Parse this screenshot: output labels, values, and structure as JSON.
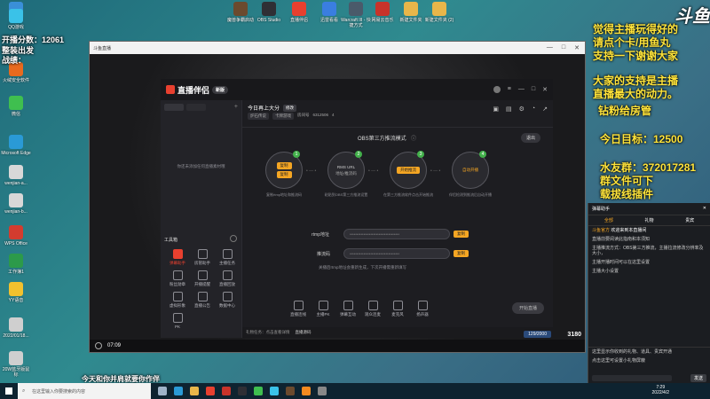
{
  "desktop": {
    "icons_left": [
      {
        "label": "此电脑",
        "color": "#3a8fd8"
      },
      {
        "label": "QQ游戏",
        "color": "#3ac2e8"
      },
      {
        "label": "火绒安全软件",
        "color": "#e86a1f"
      },
      {
        "label": "微信",
        "color": "#3fbf4f"
      },
      {
        "label": "Microsoft Edge",
        "color": "#2a9ad6"
      },
      {
        "label": "wenjian-a...",
        "color": "#d8d8d8"
      },
      {
        "label": "wenjian-b...",
        "color": "#d8d8d8"
      },
      {
        "label": "WPS Office",
        "color": "#d33c2f"
      },
      {
        "label": "工作簿1",
        "color": "#2c9a4a"
      },
      {
        "label": "YY语音",
        "color": "#f2c12e"
      },
      {
        "label": "2022/01/18...",
        "color": "#cfcfcf"
      },
      {
        "label": "20W蓝牙版鼠标",
        "color": "#cfcfcf"
      }
    ],
    "icons_top": [
      {
        "label": "魔兽争霸启动",
        "color": "#6b4a2e"
      },
      {
        "label": "OBS Studio",
        "color": "#2f2f35"
      },
      {
        "label": "直播伴侣",
        "color": "#e8402f"
      },
      {
        "label": "迅雷看看",
        "color": "#3a7ee0"
      },
      {
        "label": "Warcraft III - 快捷方式",
        "color": "#4a5a6a"
      },
      {
        "label": "网易云音乐",
        "color": "#c8332a"
      },
      {
        "label": "新建文件夹",
        "color": "#e8b64a"
      },
      {
        "label": "新建文件夹 (2)",
        "color": "#e8b64a"
      }
    ]
  },
  "overlay": {
    "score": "开播分数：12061",
    "left_line2": "整装出发",
    "left_line3": "战绩：",
    "right_l1": "觉得主播玩得好的",
    "right_l2": "请点个卡/用鱼丸",
    "right_l3": "支持一下谢谢大家",
    "right_l4": "大家的支持是主播",
    "right_l5": "直播最大的动力。",
    "right_l6": "钻粉给房管",
    "right_l7": "今日目标：12500",
    "right_l8": "水友群：372017281",
    "right_l9": "群文件可下",
    "right_l10": "载拔线插件",
    "bottom_caption": "今天和你并肩就要你作伴",
    "douyu_logo": "斗鱼"
  },
  "window": {
    "title": "斗鱼直播",
    "time": "07:09",
    "counter": "129/2000",
    "gold": "3180"
  },
  "app": {
    "name": "直播伴侣",
    "badge": "新版",
    "stream_title": "今日再上大分",
    "edit_label": "修改",
    "tag1": "炉石传说",
    "tag2": "卡牌游戏",
    "room_label": "房间号",
    "room_no": "6312506",
    "fans": "4",
    "sidebar_hint": "你还未添加任何直播素材哦",
    "toolbox_label": "工具箱",
    "tools": [
      "弹幕助手",
      "房管助手",
      "主播任务",
      "粉丝勋章",
      "开播提醒",
      "直播回放",
      "虚拟形象",
      "直播公告",
      "数据中心",
      "PK"
    ],
    "obs_mode_title": "OBS第三方推流模式",
    "exit_label": "退出",
    "steps": [
      {
        "num": "1",
        "title": "复制",
        "sub": "复制",
        "caption": "复制rtmp地址和推流码"
      },
      {
        "num": "2",
        "title": "RMS URL",
        "sub": "地址/推流码",
        "caption": "粘贴到OBS第三方推流设置"
      },
      {
        "num": "3",
        "title": "开始推流",
        "sub": "",
        "caption": "在第三方推流软件点击开始推流"
      },
      {
        "num": "4",
        "title": "自动开播",
        "sub": "",
        "caption": "伴侣检测到推流后自动开播"
      }
    ],
    "rtmp_label": "rtmp地址",
    "rtmp_value": "************************************",
    "key_label": "推流码",
    "key_value": "************************************",
    "copy_label": "复制",
    "hint_bottom": "关播后rtmp地址会重新生成，下次开播需重新填写",
    "bottom_tools": [
      "直播连线",
      "主播PK",
      "弹幕互动",
      "观众连麦",
      "麦克风",
      "扬声器"
    ],
    "start_btn": "开始直播",
    "footer_note": "礼物任务：点击查看详情",
    "footer_link": "直播源码"
  },
  "chat": {
    "title": "弹幕助手",
    "tabs": [
      "全部",
      "礼物",
      "贵宾"
    ],
    "line1": "欢迎来到本直播间",
    "line2": "直播前要阅读此指南和本须知",
    "line3": "主播推流方式：OBS第三方推流，主播拉流修改分辨率及大小，",
    "line4": "主播开播时间可以在这里设置",
    "line5": "主播大小设置",
    "line6": "这里显示你收到的礼物、道具、贵宾开通",
    "line7": "点击这里可设置小礼物屏蔽",
    "user": "斗鱼官方",
    "send_label": "发送"
  },
  "taskbar": {
    "search_placeholder": "在这里输入你要搜索的内容",
    "time": "7:29",
    "date": "2022/4/2",
    "apps": [
      {
        "name": "task-view-icon",
        "color": "#9fb3c8"
      },
      {
        "name": "edge-icon",
        "color": "#2a9ad6"
      },
      {
        "name": "explorer-icon",
        "color": "#e8b64a"
      },
      {
        "name": "live-companion-icon",
        "color": "#e8402f"
      },
      {
        "name": "netease-music-icon",
        "color": "#c8332a"
      },
      {
        "name": "obs-icon",
        "color": "#2f2f35"
      },
      {
        "name": "wechat-icon",
        "color": "#3fbf4f"
      },
      {
        "name": "qq-icon",
        "color": "#3ac2e8"
      },
      {
        "name": "warcraft-icon",
        "color": "#6b4a2e"
      },
      {
        "name": "douyu-icon",
        "color": "#f58a1f"
      },
      {
        "name": "settings-icon",
        "color": "#888"
      }
    ]
  }
}
